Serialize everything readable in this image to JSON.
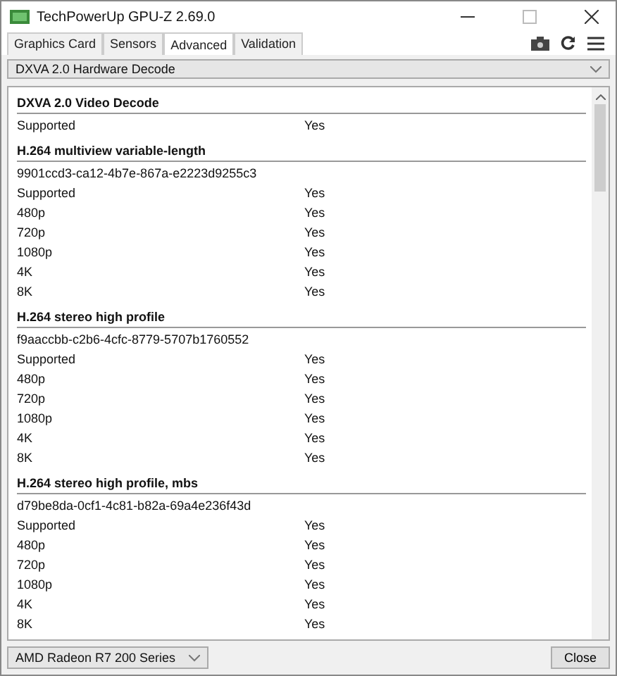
{
  "window": {
    "title": "TechPowerUp GPU-Z 2.69.0"
  },
  "tabs": [
    {
      "label": "Graphics Card",
      "selected": false
    },
    {
      "label": "Sensors",
      "selected": false
    },
    {
      "label": "Advanced",
      "selected": true
    },
    {
      "label": "Validation",
      "selected": false
    }
  ],
  "category_select": {
    "value": "DXVA 2.0 Hardware Decode"
  },
  "sections": [
    {
      "title": "DXVA 2.0 Video Decode",
      "rows": [
        {
          "label": "Supported",
          "value": "Yes"
        }
      ]
    },
    {
      "title": "H.264 multiview variable-length",
      "rows": [
        {
          "label": "9901ccd3-ca12-4b7e-867a-e2223d9255c3"
        },
        {
          "label": "Supported",
          "value": "Yes"
        },
        {
          "label": "480p",
          "value": "Yes"
        },
        {
          "label": "720p",
          "value": "Yes"
        },
        {
          "label": "1080p",
          "value": "Yes"
        },
        {
          "label": "4K",
          "value": "Yes"
        },
        {
          "label": "8K",
          "value": "Yes"
        }
      ]
    },
    {
      "title": "H.264 stereo high profile",
      "rows": [
        {
          "label": "f9aaccbb-c2b6-4cfc-8779-5707b1760552"
        },
        {
          "label": "Supported",
          "value": "Yes"
        },
        {
          "label": "480p",
          "value": "Yes"
        },
        {
          "label": "720p",
          "value": "Yes"
        },
        {
          "label": "1080p",
          "value": "Yes"
        },
        {
          "label": "4K",
          "value": "Yes"
        },
        {
          "label": "8K",
          "value": "Yes"
        }
      ]
    },
    {
      "title": "H.264 stereo high profile, mbs",
      "rows": [
        {
          "label": "d79be8da-0cf1-4c81-b82a-69a4e236f43d"
        },
        {
          "label": "Supported",
          "value": "Yes"
        },
        {
          "label": "480p",
          "value": "Yes"
        },
        {
          "label": "720p",
          "value": "Yes"
        },
        {
          "label": "1080p",
          "value": "Yes"
        },
        {
          "label": "4K",
          "value": "Yes"
        },
        {
          "label": "8K",
          "value": "Yes"
        }
      ]
    }
  ],
  "gpu_select": {
    "value": "AMD Radeon R7 200 Series"
  },
  "buttons": [
    {
      "label": "Close"
    }
  ]
}
